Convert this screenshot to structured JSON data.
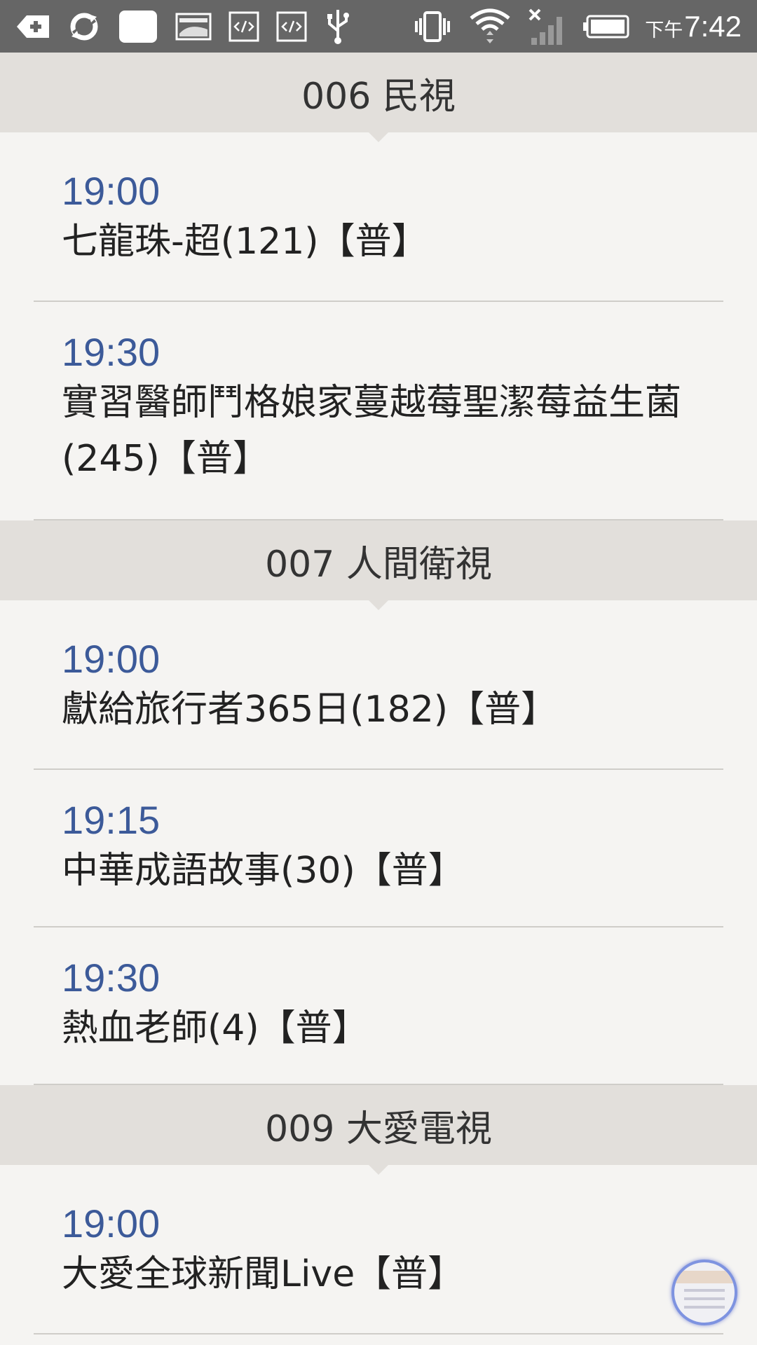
{
  "status_bar": {
    "time": "7:42",
    "ampm": "下午",
    "icons_left": [
      "add-icon",
      "sync-icon",
      "image-icon",
      "gallery-icon",
      "code-icon",
      "code-icon",
      "usb-icon"
    ],
    "icons_right": [
      "vibrate-icon",
      "wifi-icon",
      "signal-icon",
      "battery-icon"
    ]
  },
  "channels": [
    {
      "name": "006 民視",
      "programs": [
        {
          "time": "19:00",
          "title": "七龍珠-超(121)【普】"
        },
        {
          "time": "19:30",
          "title": "實習醫師鬥格娘家蔓越莓聖潔莓益生菌(245)【普】"
        }
      ]
    },
    {
      "name": "007 人間衛視",
      "programs": [
        {
          "time": "19:00",
          "title": "獻給旅行者365日(182)【普】"
        },
        {
          "time": "19:15",
          "title": "中華成語故事(30)【普】"
        },
        {
          "time": "19:30",
          "title": "熱血老師(4)【普】"
        }
      ]
    },
    {
      "name": "009 大愛電視",
      "programs": [
        {
          "time": "19:00",
          "title": "大愛全球新聞Live【普】"
        }
      ]
    }
  ]
}
